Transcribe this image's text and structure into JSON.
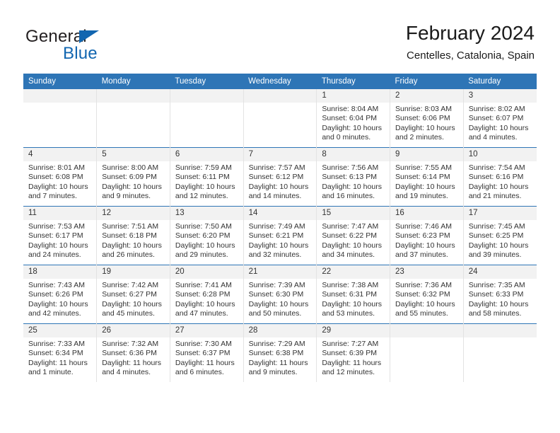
{
  "brand": {
    "name_part1": "General",
    "name_part2": "Blue",
    "logo_icon": "triangle-icon"
  },
  "header": {
    "title": "February 2024",
    "subtitle": "Centelles, Catalonia, Spain"
  },
  "colors": {
    "header_blue": "#2e75b6",
    "brand_blue": "#1266b0",
    "daynum_bg": "#f2f2f2",
    "text": "#333333"
  },
  "weekdays": [
    "Sunday",
    "Monday",
    "Tuesday",
    "Wednesday",
    "Thursday",
    "Friday",
    "Saturday"
  ],
  "weeks": [
    [
      {
        "day": "",
        "sunrise": "",
        "sunset": "",
        "daylight1": "",
        "daylight2": ""
      },
      {
        "day": "",
        "sunrise": "",
        "sunset": "",
        "daylight1": "",
        "daylight2": ""
      },
      {
        "day": "",
        "sunrise": "",
        "sunset": "",
        "daylight1": "",
        "daylight2": ""
      },
      {
        "day": "",
        "sunrise": "",
        "sunset": "",
        "daylight1": "",
        "daylight2": ""
      },
      {
        "day": "1",
        "sunrise": "Sunrise: 8:04 AM",
        "sunset": "Sunset: 6:04 PM",
        "daylight1": "Daylight: 10 hours",
        "daylight2": "and 0 minutes."
      },
      {
        "day": "2",
        "sunrise": "Sunrise: 8:03 AM",
        "sunset": "Sunset: 6:06 PM",
        "daylight1": "Daylight: 10 hours",
        "daylight2": "and 2 minutes."
      },
      {
        "day": "3",
        "sunrise": "Sunrise: 8:02 AM",
        "sunset": "Sunset: 6:07 PM",
        "daylight1": "Daylight: 10 hours",
        "daylight2": "and 4 minutes."
      }
    ],
    [
      {
        "day": "4",
        "sunrise": "Sunrise: 8:01 AM",
        "sunset": "Sunset: 6:08 PM",
        "daylight1": "Daylight: 10 hours",
        "daylight2": "and 7 minutes."
      },
      {
        "day": "5",
        "sunrise": "Sunrise: 8:00 AM",
        "sunset": "Sunset: 6:09 PM",
        "daylight1": "Daylight: 10 hours",
        "daylight2": "and 9 minutes."
      },
      {
        "day": "6",
        "sunrise": "Sunrise: 7:59 AM",
        "sunset": "Sunset: 6:11 PM",
        "daylight1": "Daylight: 10 hours",
        "daylight2": "and 12 minutes."
      },
      {
        "day": "7",
        "sunrise": "Sunrise: 7:57 AM",
        "sunset": "Sunset: 6:12 PM",
        "daylight1": "Daylight: 10 hours",
        "daylight2": "and 14 minutes."
      },
      {
        "day": "8",
        "sunrise": "Sunrise: 7:56 AM",
        "sunset": "Sunset: 6:13 PM",
        "daylight1": "Daylight: 10 hours",
        "daylight2": "and 16 minutes."
      },
      {
        "day": "9",
        "sunrise": "Sunrise: 7:55 AM",
        "sunset": "Sunset: 6:14 PM",
        "daylight1": "Daylight: 10 hours",
        "daylight2": "and 19 minutes."
      },
      {
        "day": "10",
        "sunrise": "Sunrise: 7:54 AM",
        "sunset": "Sunset: 6:16 PM",
        "daylight1": "Daylight: 10 hours",
        "daylight2": "and 21 minutes."
      }
    ],
    [
      {
        "day": "11",
        "sunrise": "Sunrise: 7:53 AM",
        "sunset": "Sunset: 6:17 PM",
        "daylight1": "Daylight: 10 hours",
        "daylight2": "and 24 minutes."
      },
      {
        "day": "12",
        "sunrise": "Sunrise: 7:51 AM",
        "sunset": "Sunset: 6:18 PM",
        "daylight1": "Daylight: 10 hours",
        "daylight2": "and 26 minutes."
      },
      {
        "day": "13",
        "sunrise": "Sunrise: 7:50 AM",
        "sunset": "Sunset: 6:20 PM",
        "daylight1": "Daylight: 10 hours",
        "daylight2": "and 29 minutes."
      },
      {
        "day": "14",
        "sunrise": "Sunrise: 7:49 AM",
        "sunset": "Sunset: 6:21 PM",
        "daylight1": "Daylight: 10 hours",
        "daylight2": "and 32 minutes."
      },
      {
        "day": "15",
        "sunrise": "Sunrise: 7:47 AM",
        "sunset": "Sunset: 6:22 PM",
        "daylight1": "Daylight: 10 hours",
        "daylight2": "and 34 minutes."
      },
      {
        "day": "16",
        "sunrise": "Sunrise: 7:46 AM",
        "sunset": "Sunset: 6:23 PM",
        "daylight1": "Daylight: 10 hours",
        "daylight2": "and 37 minutes."
      },
      {
        "day": "17",
        "sunrise": "Sunrise: 7:45 AM",
        "sunset": "Sunset: 6:25 PM",
        "daylight1": "Daylight: 10 hours",
        "daylight2": "and 39 minutes."
      }
    ],
    [
      {
        "day": "18",
        "sunrise": "Sunrise: 7:43 AM",
        "sunset": "Sunset: 6:26 PM",
        "daylight1": "Daylight: 10 hours",
        "daylight2": "and 42 minutes."
      },
      {
        "day": "19",
        "sunrise": "Sunrise: 7:42 AM",
        "sunset": "Sunset: 6:27 PM",
        "daylight1": "Daylight: 10 hours",
        "daylight2": "and 45 minutes."
      },
      {
        "day": "20",
        "sunrise": "Sunrise: 7:41 AM",
        "sunset": "Sunset: 6:28 PM",
        "daylight1": "Daylight: 10 hours",
        "daylight2": "and 47 minutes."
      },
      {
        "day": "21",
        "sunrise": "Sunrise: 7:39 AM",
        "sunset": "Sunset: 6:30 PM",
        "daylight1": "Daylight: 10 hours",
        "daylight2": "and 50 minutes."
      },
      {
        "day": "22",
        "sunrise": "Sunrise: 7:38 AM",
        "sunset": "Sunset: 6:31 PM",
        "daylight1": "Daylight: 10 hours",
        "daylight2": "and 53 minutes."
      },
      {
        "day": "23",
        "sunrise": "Sunrise: 7:36 AM",
        "sunset": "Sunset: 6:32 PM",
        "daylight1": "Daylight: 10 hours",
        "daylight2": "and 55 minutes."
      },
      {
        "day": "24",
        "sunrise": "Sunrise: 7:35 AM",
        "sunset": "Sunset: 6:33 PM",
        "daylight1": "Daylight: 10 hours",
        "daylight2": "and 58 minutes."
      }
    ],
    [
      {
        "day": "25",
        "sunrise": "Sunrise: 7:33 AM",
        "sunset": "Sunset: 6:34 PM",
        "daylight1": "Daylight: 11 hours",
        "daylight2": "and 1 minute."
      },
      {
        "day": "26",
        "sunrise": "Sunrise: 7:32 AM",
        "sunset": "Sunset: 6:36 PM",
        "daylight1": "Daylight: 11 hours",
        "daylight2": "and 4 minutes."
      },
      {
        "day": "27",
        "sunrise": "Sunrise: 7:30 AM",
        "sunset": "Sunset: 6:37 PM",
        "daylight1": "Daylight: 11 hours",
        "daylight2": "and 6 minutes."
      },
      {
        "day": "28",
        "sunrise": "Sunrise: 7:29 AM",
        "sunset": "Sunset: 6:38 PM",
        "daylight1": "Daylight: 11 hours",
        "daylight2": "and 9 minutes."
      },
      {
        "day": "29",
        "sunrise": "Sunrise: 7:27 AM",
        "sunset": "Sunset: 6:39 PM",
        "daylight1": "Daylight: 11 hours",
        "daylight2": "and 12 minutes."
      },
      {
        "day": "",
        "sunrise": "",
        "sunset": "",
        "daylight1": "",
        "daylight2": ""
      },
      {
        "day": "",
        "sunrise": "",
        "sunset": "",
        "daylight1": "",
        "daylight2": ""
      }
    ]
  ]
}
